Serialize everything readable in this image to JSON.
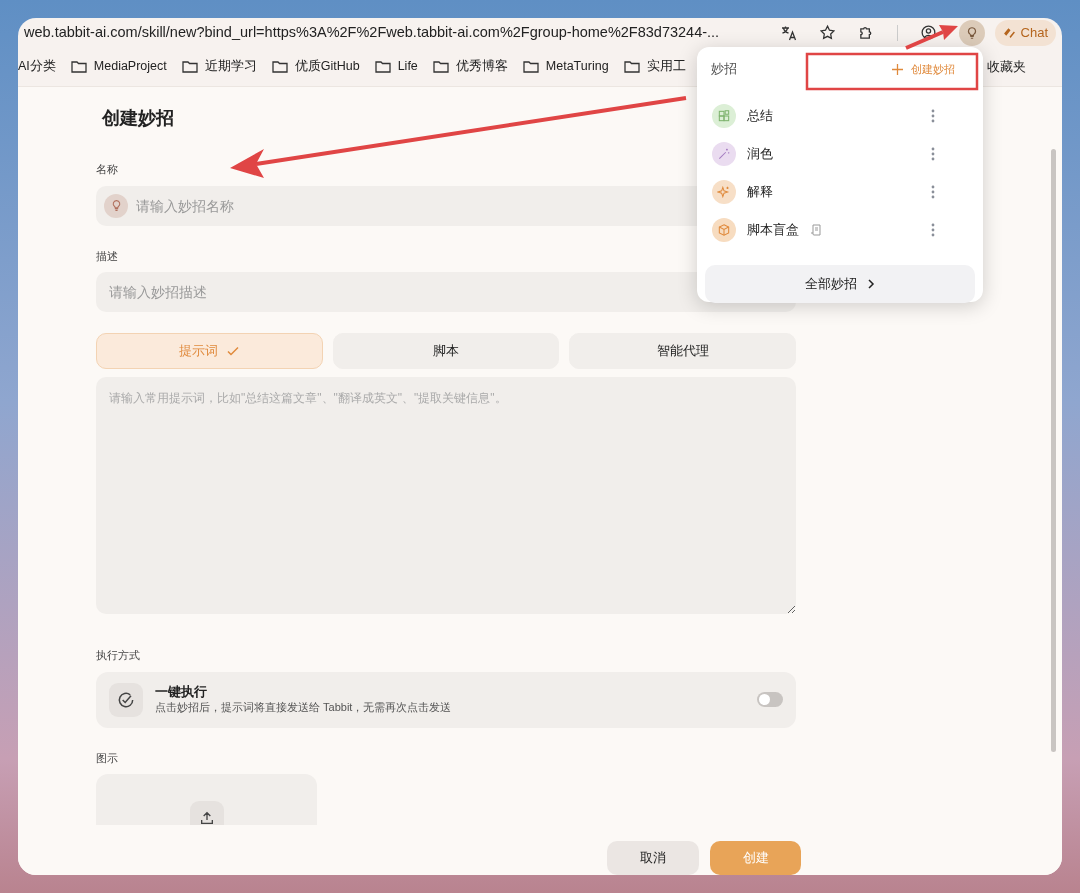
{
  "toolbar": {
    "url": "web.tabbit-ai.com/skill/new?bind_url=https%3A%2F%2Fweb.tabbit-ai.com%2Fgroup-home%2F83d73244-...",
    "chat_button": "Chat"
  },
  "bookmarks": [
    {
      "label": "AI分类",
      "kind": "plain"
    },
    {
      "label": "MediaProject",
      "kind": "folder"
    },
    {
      "label": "近期学习",
      "kind": "folder"
    },
    {
      "label": "优质GitHub",
      "kind": "folder"
    },
    {
      "label": "Life",
      "kind": "folder"
    },
    {
      "label": "优秀博客",
      "kind": "folder"
    },
    {
      "label": "MetaTuring",
      "kind": "folder"
    },
    {
      "label": "实用工",
      "kind": "folder"
    }
  ],
  "bookmarks_end": "收藏夹",
  "form": {
    "title": "创建妙招",
    "name_label": "名称",
    "name_placeholder": "请输入妙招名称",
    "description_label": "描述",
    "description_placeholder": "请输入妙招描述",
    "tabs": [
      {
        "label": "提示词",
        "selected": true
      },
      {
        "label": "脚本",
        "selected": false
      },
      {
        "label": "智能代理",
        "selected": false
      }
    ],
    "prompt_placeholder": "请输入常用提示词，比如\"总结这篇文章\"、\"翻译成英文\"、\"提取关键信息\"。",
    "execution_label": "执行方式",
    "execution": {
      "title": "一键执行",
      "description": "点击妙招后，提示词将直接发送给 Tabbit，无需再次点击发送",
      "on": false
    },
    "image_label": "图示",
    "cancel_button": "取消",
    "create_button": "创建"
  },
  "popup": {
    "title": "妙招",
    "create_button": "创建妙招",
    "items": [
      {
        "label": "总结",
        "kind": "grid",
        "color": "#dcefd6",
        "script": false
      },
      {
        "label": "润色",
        "kind": "wand",
        "color": "#eadcf0",
        "script": false
      },
      {
        "label": "解释",
        "kind": "sparkle",
        "color": "#f7dfc7",
        "script": false
      },
      {
        "label": "脚本盲盒",
        "kind": "box",
        "color": "#f7dcc0",
        "script": true
      }
    ],
    "all_button": "全部妙招"
  }
}
